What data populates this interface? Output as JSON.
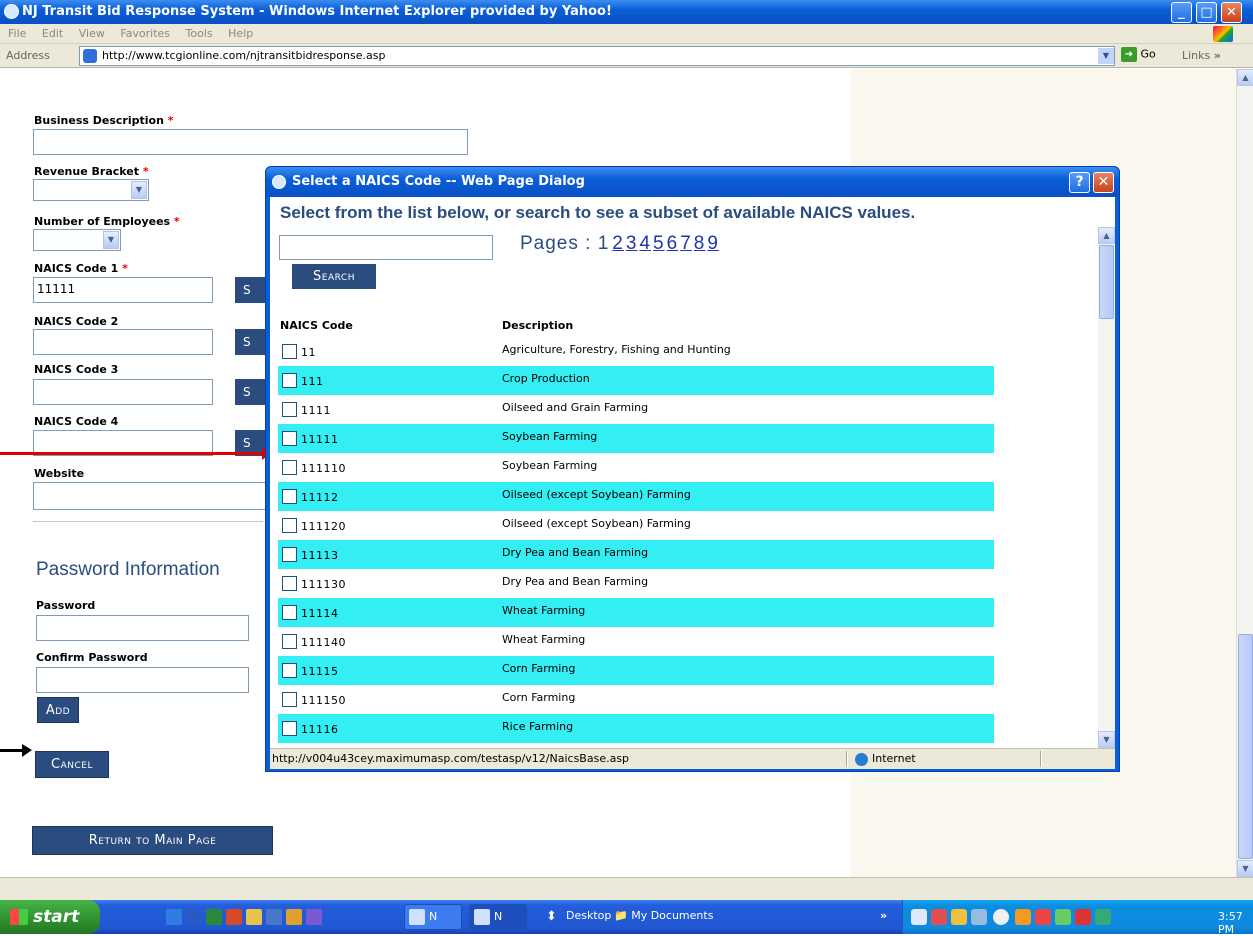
{
  "window": {
    "title": "NJ Transit Bid Response System - Windows Internet Explorer provided by Yahoo!",
    "minimize": "_",
    "maximize": "□",
    "close": "✕"
  },
  "menu": [
    "File",
    "Edit",
    "View",
    "Favorites",
    "Tools",
    "Help"
  ],
  "address": {
    "label": "Address",
    "url": "http://www.tcgionline.com/njtransitbidresponse.asp",
    "go": "Go",
    "links": "Links",
    "chevron": "»"
  },
  "form": {
    "business_description": {
      "label": "Business Description",
      "required": "*",
      "value": ""
    },
    "revenue_bracket": {
      "label": "Revenue Bracket",
      "required": "*",
      "value": ""
    },
    "number_of_employees": {
      "label": "Number of Employees",
      "required": "*",
      "value": ""
    },
    "naics1": {
      "label": "NAICS Code 1",
      "required": "*",
      "value": "11111",
      "button": "S"
    },
    "naics2": {
      "label": "NAICS Code 2",
      "value": "",
      "button": "S"
    },
    "naics3": {
      "label": "NAICS Code 3",
      "value": "",
      "button": "S"
    },
    "naics4": {
      "label": "NAICS Code 4",
      "value": "",
      "button": "S"
    },
    "website": {
      "label": "Website",
      "value": ""
    },
    "password_section_title": "Password Information",
    "password": {
      "label": "Password",
      "value": ""
    },
    "confirm_password": {
      "label": "Confirm Password",
      "value": ""
    },
    "add_button": "Add",
    "cancel_button": "Cancel",
    "return_button": "Return to Main Page"
  },
  "dialog": {
    "title": "Select a NAICS Code -- Web Page Dialog",
    "help": "?",
    "close": "✕",
    "instructions": "Select from the list below, or search to see a subset of available NAICS values.",
    "search_value": "",
    "pages_label": "Pages :",
    "current_page": "1",
    "pages": [
      "2",
      "3",
      "4",
      "5",
      "6",
      "7",
      "8",
      "9"
    ],
    "search_button": "Search",
    "col_code": "NAICS Code",
    "col_desc": "Description",
    "rows": [
      {
        "code": "11",
        "desc": "Agriculture, Forestry, Fishing and Hunting"
      },
      {
        "code": "111",
        "desc": "Crop Production"
      },
      {
        "code": "1111",
        "desc": "Oilseed and Grain Farming"
      },
      {
        "code": "11111",
        "desc": "Soybean Farming"
      },
      {
        "code": "111110",
        "desc": "Soybean Farming"
      },
      {
        "code": "11112",
        "desc": "Oilseed (except Soybean) Farming"
      },
      {
        "code": "111120",
        "desc": "Oilseed (except Soybean) Farming"
      },
      {
        "code": "11113",
        "desc": "Dry Pea and Bean Farming"
      },
      {
        "code": "111130",
        "desc": "Dry Pea and Bean Farming"
      },
      {
        "code": "11114",
        "desc": "Wheat Farming"
      },
      {
        "code": "111140",
        "desc": "Wheat Farming"
      },
      {
        "code": "11115",
        "desc": "Corn Farming"
      },
      {
        "code": "111150",
        "desc": "Corn Farming"
      },
      {
        "code": "11116",
        "desc": "Rice Farming"
      }
    ],
    "status_url": "http://v004u43cey.maximumasp.com/testasp/v12/NaicsBase.asp",
    "status_zone": "Internet"
  },
  "taskbar": {
    "start": "start",
    "task1": "N",
    "task2": "N",
    "desktop": "Desktop",
    "my_documents": "My Documents",
    "tray_chevron": "»",
    "clock": "3:57 PM"
  },
  "colors": {
    "navy": "#2b4c7e",
    "row_highlight": "#33eef2",
    "arrow_red": "#e00000",
    "required": "#e00"
  }
}
